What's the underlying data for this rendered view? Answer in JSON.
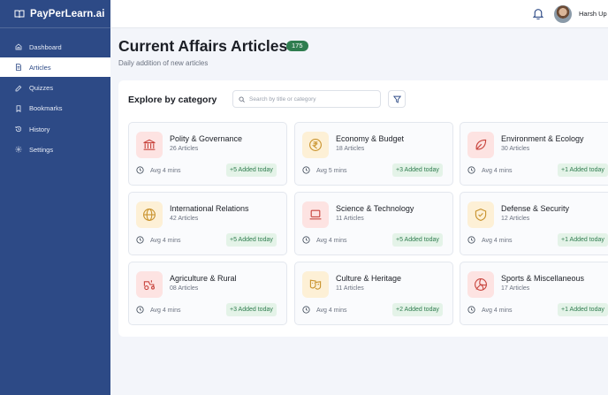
{
  "brand": {
    "name": "PayPerLearn.ai"
  },
  "nav": [
    {
      "label": "Dashboard",
      "icon": "home-icon",
      "active": false
    },
    {
      "label": "Articles",
      "icon": "document-icon",
      "active": true
    },
    {
      "label": "Quizzes",
      "icon": "pencil-icon",
      "active": false
    },
    {
      "label": "Bookmarks",
      "icon": "bookmark-icon",
      "active": false
    },
    {
      "label": "History",
      "icon": "history-icon",
      "active": false
    },
    {
      "label": "Settings",
      "icon": "gear-icon",
      "active": false
    }
  ],
  "user": {
    "name": "Harsh Up"
  },
  "header": {
    "title": "Current Affairs Articles",
    "count": "175",
    "subtitle": "Daily addition of new articles"
  },
  "explore": {
    "title": "Explore by category",
    "search_placeholder": "Search by title or category",
    "search_value": ""
  },
  "categories": [
    {
      "title": "Polity & Governance",
      "count": "26 Articles",
      "time": "Avg 4 mins",
      "added": "+5 Added today",
      "icon": "government-building-icon",
      "tint": "red"
    },
    {
      "title": "Economy & Budget",
      "count": "18 Articles",
      "time": "Avg 5 mins",
      "added": "+3 Added today",
      "icon": "rupee-icon",
      "tint": "amber"
    },
    {
      "title": "Environment & Ecology",
      "count": "30 Articles",
      "time": "Avg 4 mins",
      "added": "+1 Added today",
      "icon": "leaf-icon",
      "tint": "red"
    },
    {
      "title": "International Relations",
      "count": "42 Articles",
      "time": "Avg 4 mins",
      "added": "+5 Added today",
      "icon": "globe-icon",
      "tint": "amber"
    },
    {
      "title": "Science & Technology",
      "count": "11 Articles",
      "time": "Avg 4 mins",
      "added": "+5 Added today",
      "icon": "laptop-icon",
      "tint": "red"
    },
    {
      "title": "Defense & Security",
      "count": "12 Articles",
      "time": "Avg 4 mins",
      "added": "+1 Added today",
      "icon": "shield-icon",
      "tint": "amber"
    },
    {
      "title": "Agriculture & Rural",
      "count": "08 Articles",
      "time": "Avg 4 mins",
      "added": "+3 Added today",
      "icon": "tractor-icon",
      "tint": "red"
    },
    {
      "title": "Culture & Heritage",
      "count": "11 Articles",
      "time": "Avg 4 mins",
      "added": "+2 Added today",
      "icon": "theater-masks-icon",
      "tint": "amber"
    },
    {
      "title": "Sports & Miscellaneous",
      "count": "17 Articles",
      "time": "Avg 4 mins",
      "added": "+1 Added today",
      "icon": "volleyball-icon",
      "tint": "red"
    }
  ],
  "colors": {
    "sidebar": "#2d4a86",
    "accent_green": "#2f7d4f",
    "icon_red": "#c8443d",
    "icon_amber": "#c9932e"
  }
}
